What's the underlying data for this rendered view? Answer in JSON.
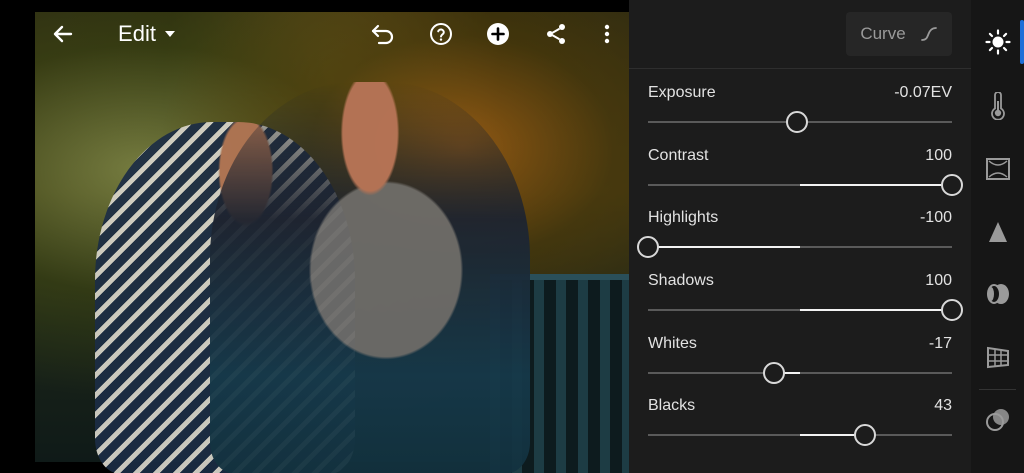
{
  "toolbar": {
    "back_icon": "arrow-left-icon",
    "mode_label": "Edit",
    "mode_dropdown_icon": "caret-down-icon",
    "undo_icon": "undo-icon",
    "help_icon": "help-circle-icon",
    "add_icon": "add-circle-icon",
    "share_icon": "share-icon",
    "more_icon": "more-vertical-icon"
  },
  "panel": {
    "curve_label": "Curve",
    "curve_icon": "curve-icon",
    "sliders": [
      {
        "label": "Exposure",
        "value": "-0.07EV",
        "position": 0.49
      },
      {
        "label": "Contrast",
        "value": "100",
        "position": 1.0
      },
      {
        "label": "Highlights",
        "value": "-100",
        "position": 0.0
      },
      {
        "label": "Shadows",
        "value": "100",
        "position": 1.0
      },
      {
        "label": "Whites",
        "value": "-17",
        "position": 0.415
      },
      {
        "label": "Blacks",
        "value": "43",
        "position": 0.715
      }
    ]
  },
  "rail": {
    "items": [
      {
        "icon": "light-icon",
        "active": true
      },
      {
        "icon": "color-temperature-icon",
        "active": false
      },
      {
        "icon": "effects-icon",
        "active": false
      },
      {
        "icon": "detail-icon",
        "active": false
      },
      {
        "icon": "optics-icon",
        "active": false
      },
      {
        "icon": "geometry-icon",
        "active": false
      },
      {
        "icon": "presets-icon",
        "active": false
      }
    ]
  },
  "colors": {
    "panel_bg": "#1c1c1c",
    "rail_bg": "#161616",
    "accent": "#1e6fd8",
    "slider_fill": "#f2f2f2",
    "slider_track": "#5a5a5a"
  }
}
